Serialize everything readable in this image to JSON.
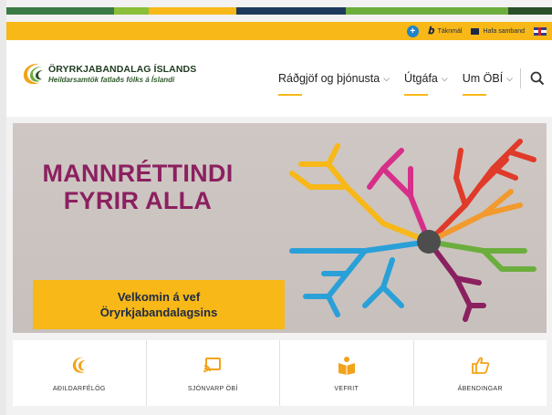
{
  "colors": {
    "stripe": [
      "#3a7a45",
      "#8bbf3a",
      "#f7b818",
      "#1d3a5c",
      "#6cae3e",
      "#2a4f2a"
    ],
    "utility_bar": "#f7b818",
    "hero_title": "#8b2060",
    "hero_box": "#f7b818",
    "tile_icon": "#f2a31a"
  },
  "utility": {
    "accessibility_icon": "accessibility-icon",
    "sign_language_label": "Táknmál",
    "contact_label": "Hafa samband",
    "language_icon": "uk-flag-icon"
  },
  "logo": {
    "name": "ÖRYRKJABANDALAG ÍSLANDS",
    "tagline": "Heildarsamtök fatlaðs fólks á Íslandi"
  },
  "nav": {
    "items": [
      {
        "label": "Ráðgjöf og þjónusta"
      },
      {
        "label": "Útgáfa"
      },
      {
        "label": "Um ÖBÍ"
      }
    ],
    "search_icon": "search-icon"
  },
  "hero": {
    "title_line1": "MANNRÉTTINDI",
    "title_line2": "FYRIR ALLA",
    "welcome_line1": "Velkomin á vef",
    "welcome_line2": "Öryrkjabandalagsins"
  },
  "tiles": [
    {
      "label": "AÐILDARFÉLÖG",
      "icon": "member-logo-icon"
    },
    {
      "label": "SJÓNVARP ÖBÍ",
      "icon": "cast-tv-icon"
    },
    {
      "label": "VEFRIT",
      "icon": "reader-book-icon"
    },
    {
      "label": "ÁBENDINGAR",
      "icon": "hand-pointing-icon"
    }
  ]
}
